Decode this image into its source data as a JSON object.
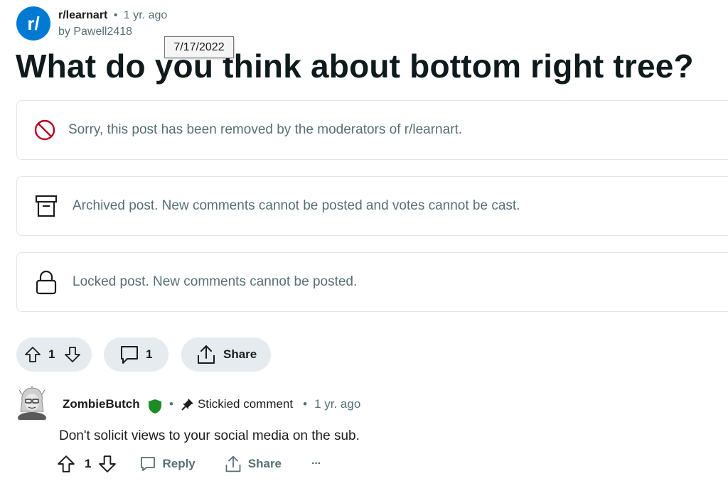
{
  "post": {
    "subreddit": "r/learnart",
    "subreddit_avatar_text": "r/",
    "separator": "•",
    "age": "1 yr. ago",
    "author": "by Pawell2418",
    "tooltip_date": "7/17/2022",
    "title": "What do you think about bottom right tree?"
  },
  "notices": {
    "removed": "Sorry, this post has been removed by the moderators of r/learnart.",
    "archived": "Archived post. New comments cannot be posted and votes cannot be cast.",
    "locked": "Locked post. New comments cannot be posted."
  },
  "actions": {
    "vote_count": "1",
    "comment_count": "1",
    "share_label": "Share"
  },
  "comment": {
    "author": "ZombieButch",
    "separator": "•",
    "stickied_label": "Stickied comment",
    "age": "1 yr. ago",
    "body": "Don't solicit views to your social media on the sub.",
    "vote_count": "1",
    "reply_label": "Reply",
    "share_label": "Share",
    "more_label": "···"
  },
  "colors": {
    "subreddit_blue": "#0079d3",
    "removed_red": "#b8001f",
    "mod_green": "#1f8b24",
    "pill_bg": "#e5ebee",
    "muted_text": "#576f76"
  }
}
